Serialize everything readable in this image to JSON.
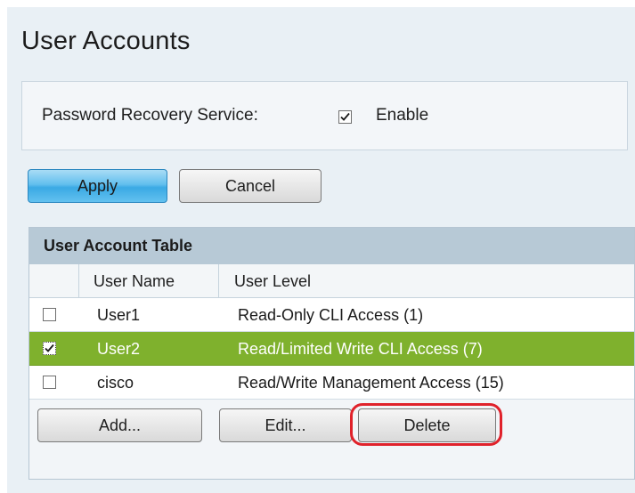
{
  "page": {
    "title": "User Accounts"
  },
  "recovery": {
    "label": "Password Recovery Service:",
    "enable_label": "Enable",
    "enabled": true
  },
  "actions": {
    "apply_label": "Apply",
    "cancel_label": "Cancel"
  },
  "table": {
    "title": "User Account Table",
    "columns": [
      "User Name",
      "User Level"
    ],
    "rows": [
      {
        "name": "User1",
        "level": "Read-Only CLI Access (1)",
        "checked": false,
        "selected": false
      },
      {
        "name": "User2",
        "level": "Read/Limited Write CLI Access (7)",
        "checked": true,
        "selected": true
      },
      {
        "name": "cisco",
        "level": "Read/Write Management Access (15)",
        "checked": false,
        "selected": false
      }
    ],
    "add_label": "Add...",
    "edit_label": "Edit...",
    "delete_label": "Delete"
  },
  "colors": {
    "apply_accent": "#3aa9e4",
    "selected_row": "#7fb12d",
    "highlight": "#e0222b",
    "panel_bg": "#e9f0f5",
    "table_header_bg": "#b7c9d6"
  }
}
